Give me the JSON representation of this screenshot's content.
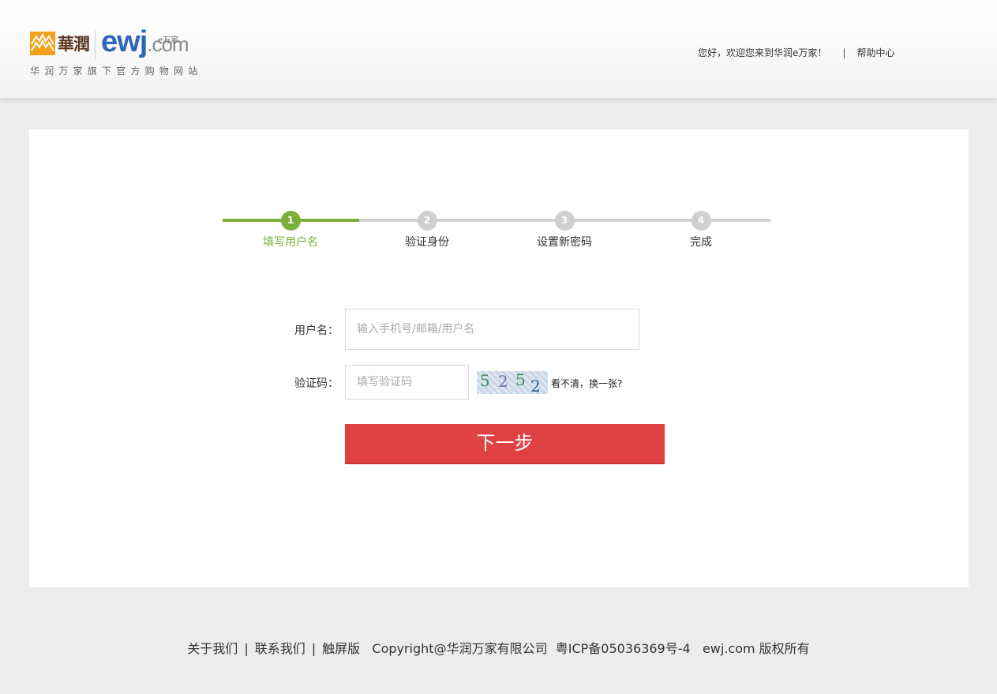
{
  "header": {
    "logo": {
      "brand_cn": "華潤",
      "brand_ewj": "ewj",
      "brand_com": ".com",
      "brand_small": "e万家",
      "tagline": "华润万家旗下官方购物网站"
    },
    "welcome_text": "您好，欢迎您来到华润e万家！",
    "separator": "|",
    "help_link": "帮助中心"
  },
  "steps": [
    {
      "number": "1",
      "label": "填写用户名",
      "active": true
    },
    {
      "number": "2",
      "label": "验证身份",
      "active": false
    },
    {
      "number": "3",
      "label": "设置新密码",
      "active": false
    },
    {
      "number": "4",
      "label": "完成",
      "active": false
    }
  ],
  "form": {
    "username_label": "用户名：",
    "username_placeholder": "输入手机号/邮箱/用户名",
    "username_value": "",
    "captcha_label": "验证码：",
    "captcha_placeholder": "填写验证码",
    "captcha_value": "",
    "captcha_digits": [
      "5",
      "2",
      "5",
      "2"
    ],
    "captcha_refresh": "看不清，换一张?",
    "next_button": "下一步"
  },
  "footer": {
    "about": "关于我们",
    "contact": "联系我们",
    "touch": "触屏版",
    "sep": "|",
    "copyright": "Copyright@华润万家有限公司",
    "icp": "粤ICP备05036369号-4",
    "rights": "ewj.com 版权所有"
  },
  "colors": {
    "accent_green": "#7cb139",
    "button_red": "#e04142",
    "step_gray": "#cfcfcf"
  }
}
